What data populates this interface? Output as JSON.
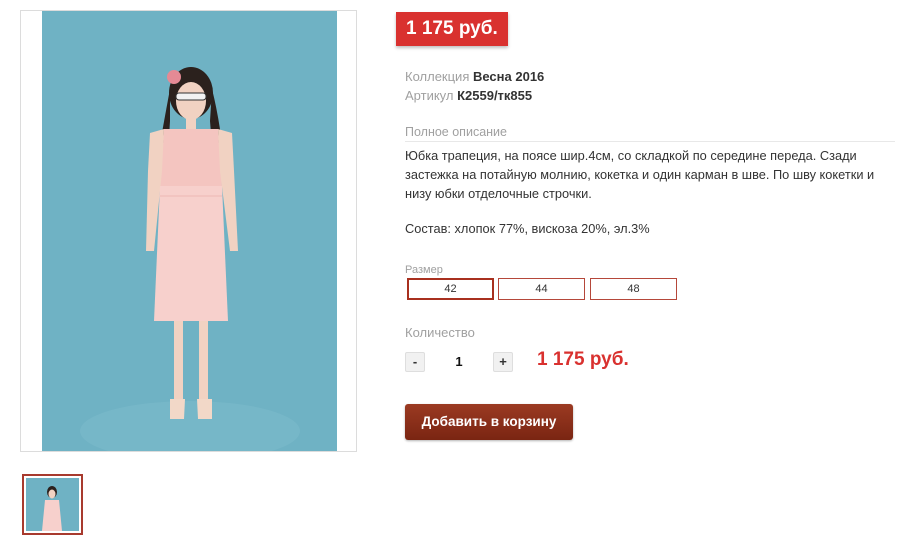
{
  "product": {
    "price_badge": "1 175 руб.",
    "collection_label": "Коллекция",
    "collection_value": "Весна 2016",
    "article_label": "Артикул",
    "article_value": "К2559/тк855",
    "description_title": "Полное описание",
    "description": "Юбка трапеция, на поясе шир.4см, со складкой по середине переда. Сзади застежка на потайную молнию, кокетка и один карман в шве.  По шву кокетки и низу юбки отделочные строчки.",
    "composition": "Состав: хлопок 77%, вискоза 20%, эл.3%"
  },
  "sizes": {
    "label": "Размер",
    "options": [
      "42",
      "44",
      "48"
    ],
    "selected": "42"
  },
  "quantity": {
    "label": "Количество",
    "minus": "-",
    "value": "1",
    "plus": "+"
  },
  "total_price": "1 175 руб.",
  "add_to_cart_label": "Добавить в корзину",
  "colors": {
    "accent_red": "#d9312f",
    "button_brown": "#8b2e19",
    "photo_background": "#6fb2c4"
  }
}
